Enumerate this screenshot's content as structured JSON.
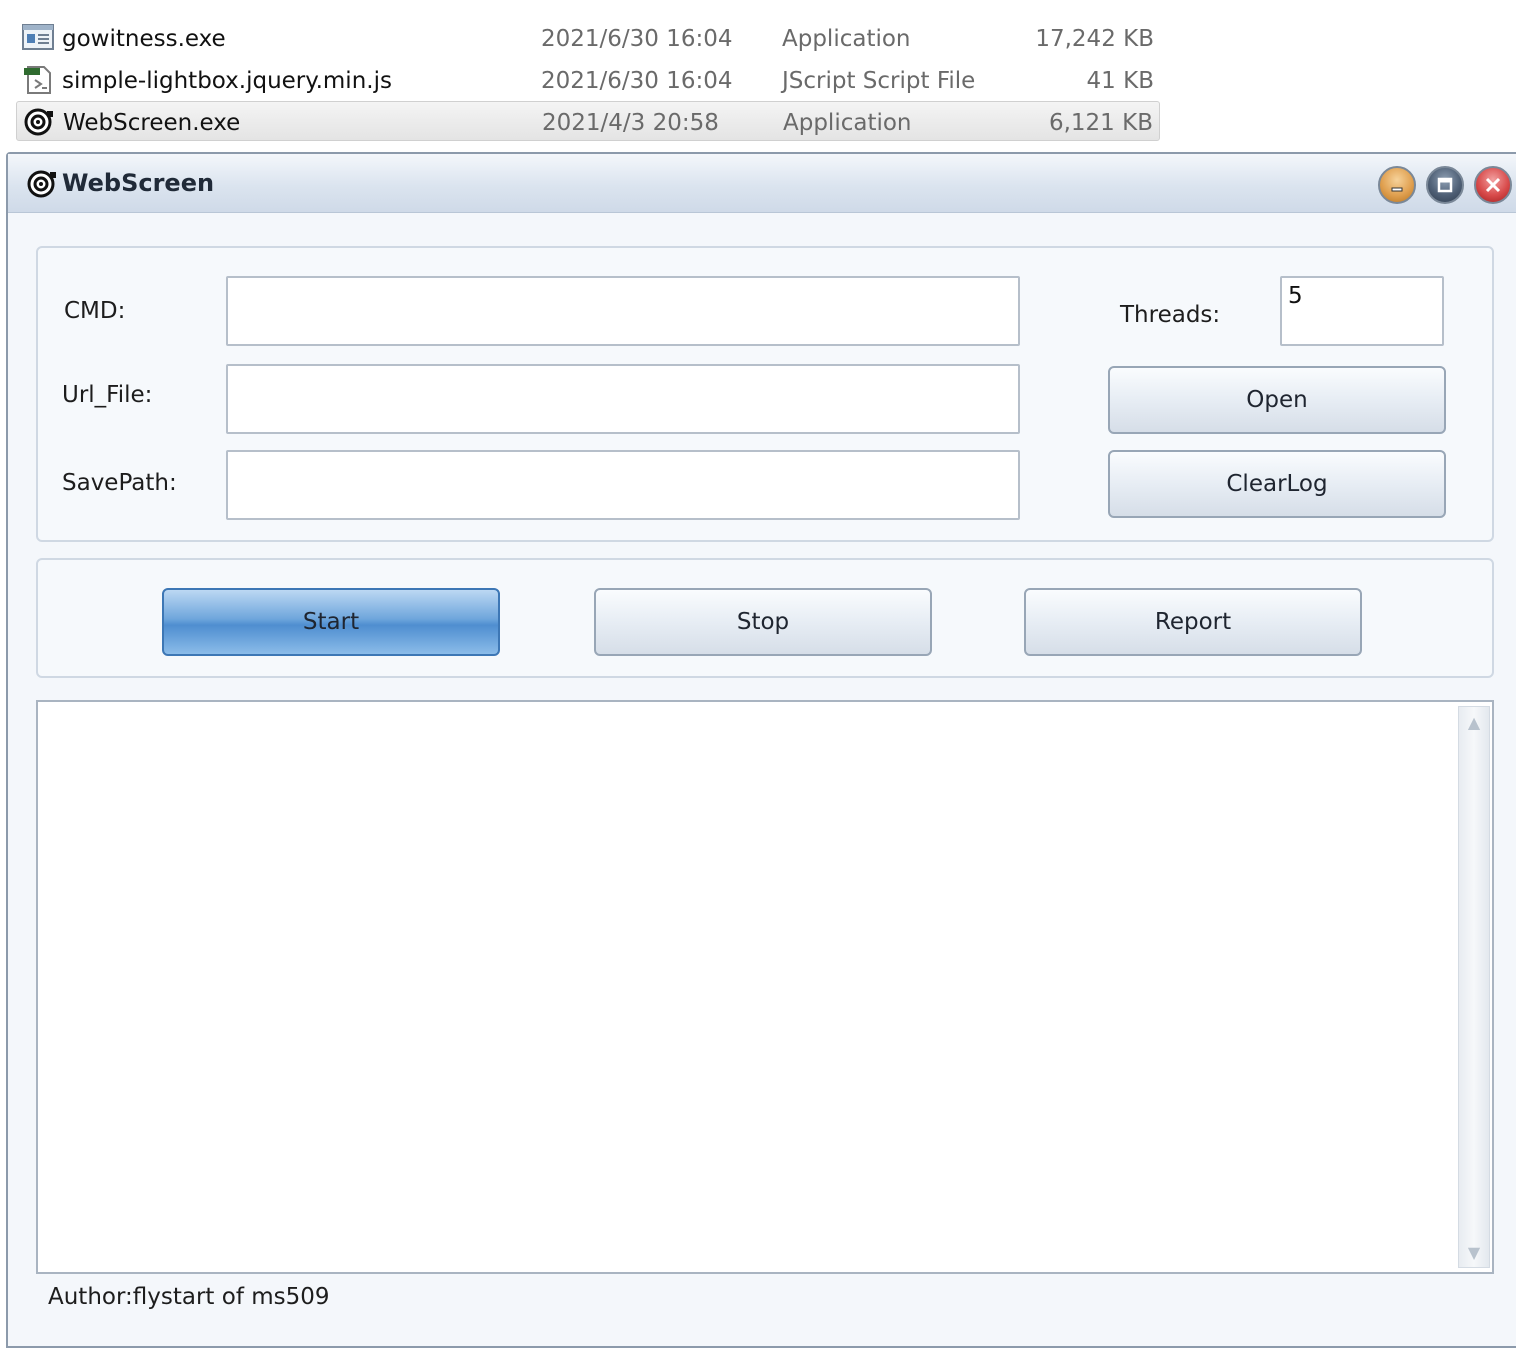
{
  "files": [
    {
      "name": "gowitness.exe",
      "date": "2021/6/30 16:04",
      "type": "Application",
      "size": "17,242 KB",
      "icon": "app-window-icon",
      "selected": false
    },
    {
      "name": "simple-lightbox.jquery.min.js",
      "date": "2021/6/30 16:04",
      "type": "JScript Script File",
      "size": "41 KB",
      "icon": "script-file-icon",
      "selected": false
    },
    {
      "name": "WebScreen.exe",
      "date": "2021/4/3 20:58",
      "type": "Application",
      "size": "6,121 KB",
      "icon": "webscreen-app-icon",
      "selected": true
    }
  ],
  "window": {
    "title": "WebScreen",
    "controls": [
      "minimize",
      "maximize",
      "close"
    ]
  },
  "form": {
    "cmd_label": "CMD:",
    "cmd_value": "",
    "url_file_label": "Url_File:",
    "url_file_value": "",
    "save_path_label": "SavePath:",
    "save_path_value": "",
    "threads_label": "Threads:",
    "threads_value": "5",
    "open_label": "Open",
    "clear_log_label": "ClearLog"
  },
  "actions": {
    "start_label": "Start",
    "stop_label": "Stop",
    "report_label": "Report"
  },
  "log": {
    "content": ""
  },
  "footer": {
    "author": "Author:flystart of ms509"
  },
  "colors": {
    "accent": "#4f8ed0",
    "titlebar": "#dbe4ef",
    "close": "#d84b4b",
    "minimize": "#e0a050"
  }
}
